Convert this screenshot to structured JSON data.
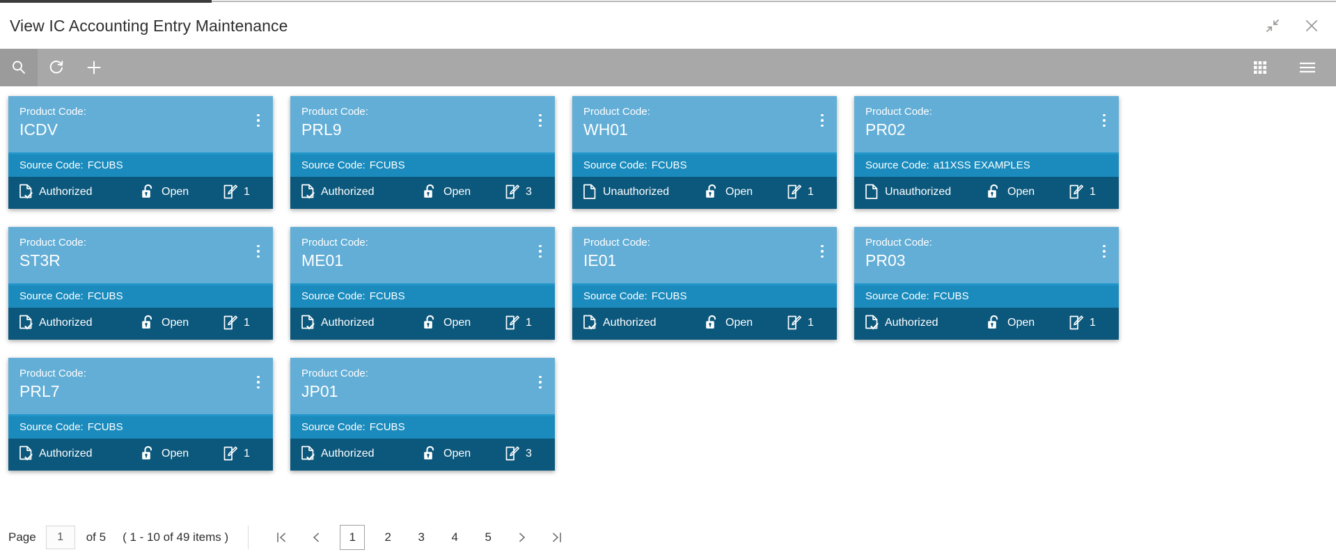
{
  "window": {
    "title": "View IC Accounting Entry Maintenance",
    "minimize_icon": "collapse-arrows-icon",
    "close_icon": "close-icon"
  },
  "toolbar": {
    "search_icon": "search-icon",
    "refresh_icon": "refresh-icon",
    "add_icon": "plus-icon",
    "tile_view_icon": "grid-view-icon",
    "menu_icon": "hamburger-menu-icon"
  },
  "card_labels": {
    "product_code": "Product Code:",
    "source_code": "Source Code:",
    "kebab_icon": "more-options-icon",
    "authorized_icon": "document-check-icon",
    "unauthorized_icon": "document-icon",
    "lock_icon": "unlocked-padlock-icon",
    "edit_icon": "edit-page-icon"
  },
  "cards": [
    {
      "product_code": "ICDV",
      "source_code": "FCUBS",
      "auth_status": "Authorized",
      "auth_type": "authorized",
      "lock_status": "Open",
      "mod_count": "1"
    },
    {
      "product_code": "PRL9",
      "source_code": "FCUBS",
      "auth_status": "Authorized",
      "auth_type": "authorized",
      "lock_status": "Open",
      "mod_count": "3"
    },
    {
      "product_code": "WH01",
      "source_code": "FCUBS",
      "auth_status": "Unauthorized",
      "auth_type": "unauthorized",
      "lock_status": "Open",
      "mod_count": "1"
    },
    {
      "product_code": "PR02",
      "source_code": "a11XSS EXAMPLES",
      "auth_status": "Unauthorized",
      "auth_type": "unauthorized",
      "lock_status": "Open",
      "mod_count": "1"
    },
    {
      "product_code": "ST3R",
      "source_code": "FCUBS",
      "auth_status": "Authorized",
      "auth_type": "authorized",
      "lock_status": "Open",
      "mod_count": "1"
    },
    {
      "product_code": "ME01",
      "source_code": "FCUBS",
      "auth_status": "Authorized",
      "auth_type": "authorized",
      "lock_status": "Open",
      "mod_count": "1"
    },
    {
      "product_code": "IE01",
      "source_code": "FCUBS",
      "auth_status": "Authorized",
      "auth_type": "authorized",
      "lock_status": "Open",
      "mod_count": "1"
    },
    {
      "product_code": "PR03",
      "source_code": "FCUBS",
      "auth_status": "Authorized",
      "auth_type": "authorized",
      "lock_status": "Open",
      "mod_count": "1"
    },
    {
      "product_code": "PRL7",
      "source_code": "FCUBS",
      "auth_status": "Authorized",
      "auth_type": "authorized",
      "lock_status": "Open",
      "mod_count": "1"
    },
    {
      "product_code": "JP01",
      "source_code": "FCUBS",
      "auth_status": "Authorized",
      "auth_type": "authorized",
      "lock_status": "Open",
      "mod_count": "3"
    }
  ],
  "pagination": {
    "page_label": "Page",
    "page_value": "1",
    "of_text": "of 5",
    "items_text": "( 1 - 10 of 49 items )",
    "first_icon": "first-page-icon",
    "prev_icon": "previous-page-icon",
    "next_icon": "next-page-icon",
    "last_icon": "last-page-icon",
    "pages": [
      "1",
      "2",
      "3",
      "4",
      "5"
    ],
    "current_page": "1"
  },
  "colors": {
    "card_header": "#63aed6",
    "card_accent": "#2196c9",
    "card_sub": "#1b8bbd",
    "card_footer": "#0c587c",
    "toolbar": "#a8a8a8"
  }
}
